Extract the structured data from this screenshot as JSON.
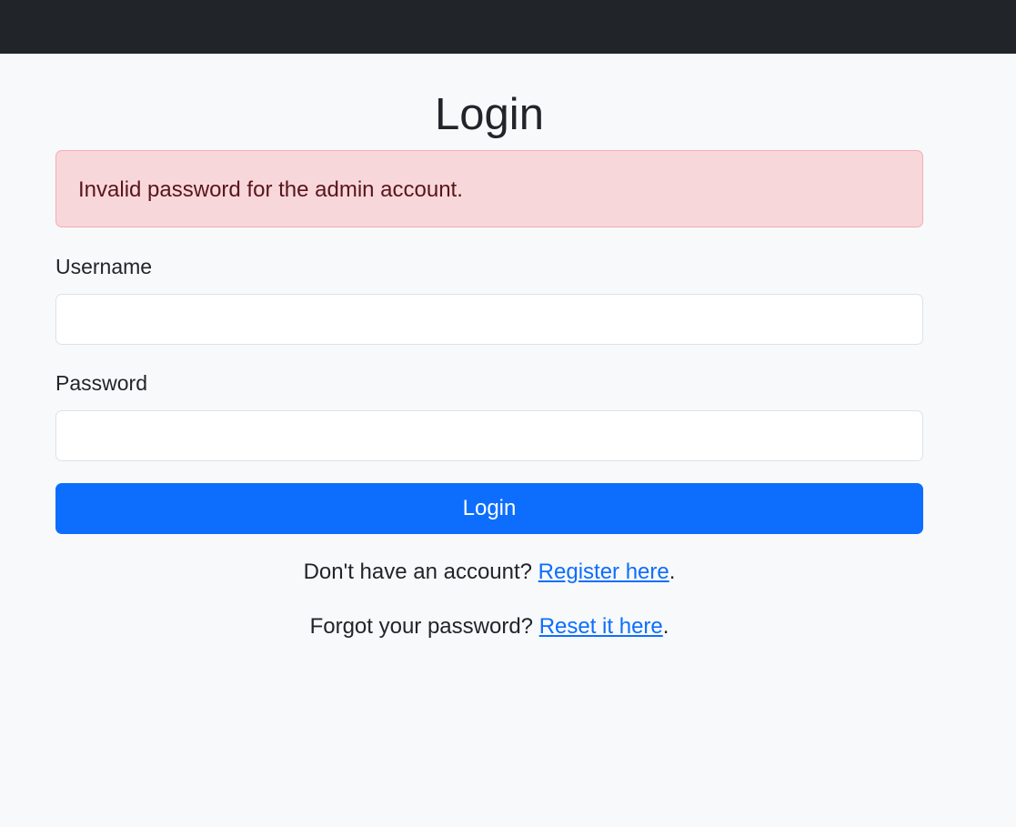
{
  "page": {
    "title": "Login"
  },
  "alert": {
    "message": "Invalid password for the admin account."
  },
  "form": {
    "username_label": "Username",
    "username_value": "",
    "password_label": "Password",
    "password_value": "",
    "submit_label": "Login"
  },
  "register": {
    "prompt": "Don't have an account? ",
    "link_text": "Register here",
    "suffix": "."
  },
  "reset": {
    "prompt": "Forgot your password? ",
    "link_text": "Reset it here",
    "suffix": "."
  },
  "colors": {
    "navbar": "#212529",
    "background": "#f8f9fa",
    "alert_bg": "#f8d7da",
    "alert_text": "#58151c",
    "primary": "#0d6efd"
  }
}
